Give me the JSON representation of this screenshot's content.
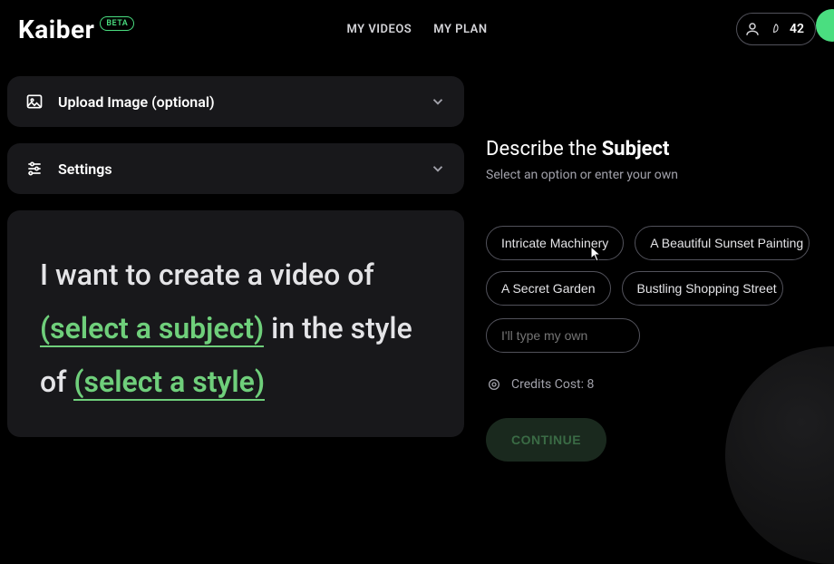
{
  "header": {
    "logo": "Kaiber",
    "badge": "BETA",
    "nav": [
      "MY VIDEOS",
      "MY PLAN"
    ],
    "credits": "42"
  },
  "panels": {
    "upload": "Upload Image (optional)",
    "settings": "Settings"
  },
  "prompt": {
    "prefix": "I want to create a video of ",
    "subject_placeholder": "(select a subject)",
    "middle": " in the style of ",
    "style_placeholder": "(select a style)"
  },
  "describe": {
    "prefix": "Describe the ",
    "bold": "Subject",
    "sub": "Select an option or enter your own",
    "chips": [
      "Intricate Machinery",
      "A Beautiful Sunset Painting",
      "A Secret Garden",
      "Bustling Shopping Street"
    ],
    "type_own_placeholder": "I'll type my own",
    "credits_label": "Credits Cost: 8",
    "continue": "CONTINUE"
  }
}
